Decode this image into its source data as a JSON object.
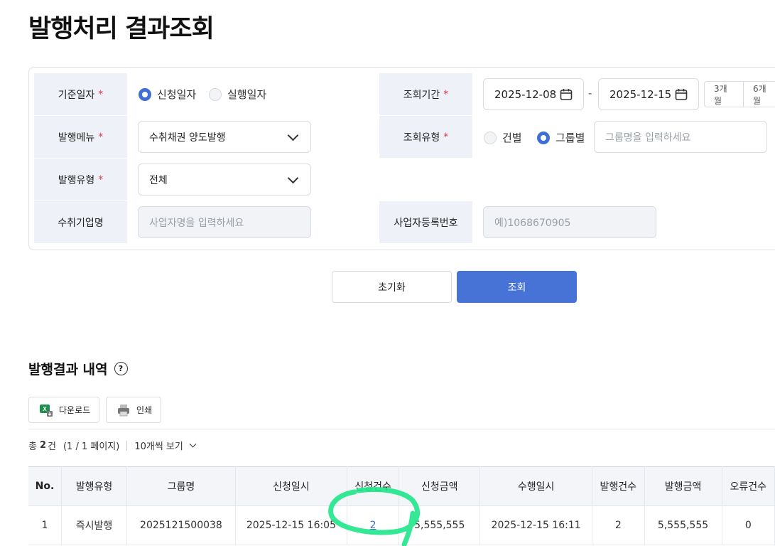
{
  "page": {
    "title": "발행처리 결과조회"
  },
  "form": {
    "base_date": {
      "label": "기준일자",
      "options": [
        "신청일자",
        "실행일자"
      ],
      "selected": "신청일자"
    },
    "period": {
      "label": "조회기간",
      "start": "2025-12-08",
      "separator": "-",
      "end": "2025-12-15",
      "quick": [
        "3개월",
        "6개월"
      ]
    },
    "menu": {
      "label": "발행메뉴",
      "value": "수취채권 양도발행"
    },
    "query_type": {
      "label": "조회유형",
      "options": [
        "건별",
        "그룹별"
      ],
      "selected": "그룹별",
      "group_placeholder": "그룹명을 입력하세요"
    },
    "issue_type": {
      "label": "발행유형",
      "value": "전체"
    },
    "company": {
      "label": "수취기업명",
      "placeholder": "사업자명을 입력하세요"
    },
    "bizno": {
      "label": "사업자등록번호",
      "placeholder": "예)1068670905"
    },
    "required_mark": "*"
  },
  "buttons": {
    "reset": "초기화",
    "search": "조회"
  },
  "results": {
    "title": "발행결과 내역",
    "help_icon": "question-circle-icon",
    "download": "다운로드",
    "print": "인쇄",
    "summary": {
      "total_prefix": "총",
      "count": "2",
      "unit": "건",
      "pages": "(1 / 1 페이지)",
      "per_page": "10개씩 보기"
    },
    "columns": [
      "No.",
      "발행유형",
      "그룹명",
      "신청일시",
      "신청건수",
      "신청금액",
      "수행일시",
      "발행건수",
      "발행금액",
      "오류건수"
    ],
    "rows": [
      [
        "1",
        "즉시발행",
        "2025121500038",
        "2025-12-15 16:05",
        "2",
        "5,555,555",
        "2025-12-15 16:11",
        "2",
        "5,555,555",
        "0"
      ]
    ]
  },
  "colors": {
    "accent": "#4772d6",
    "required": "#e0364c",
    "label_bg": "#eef2f8",
    "annotation": "#1fe58a"
  }
}
